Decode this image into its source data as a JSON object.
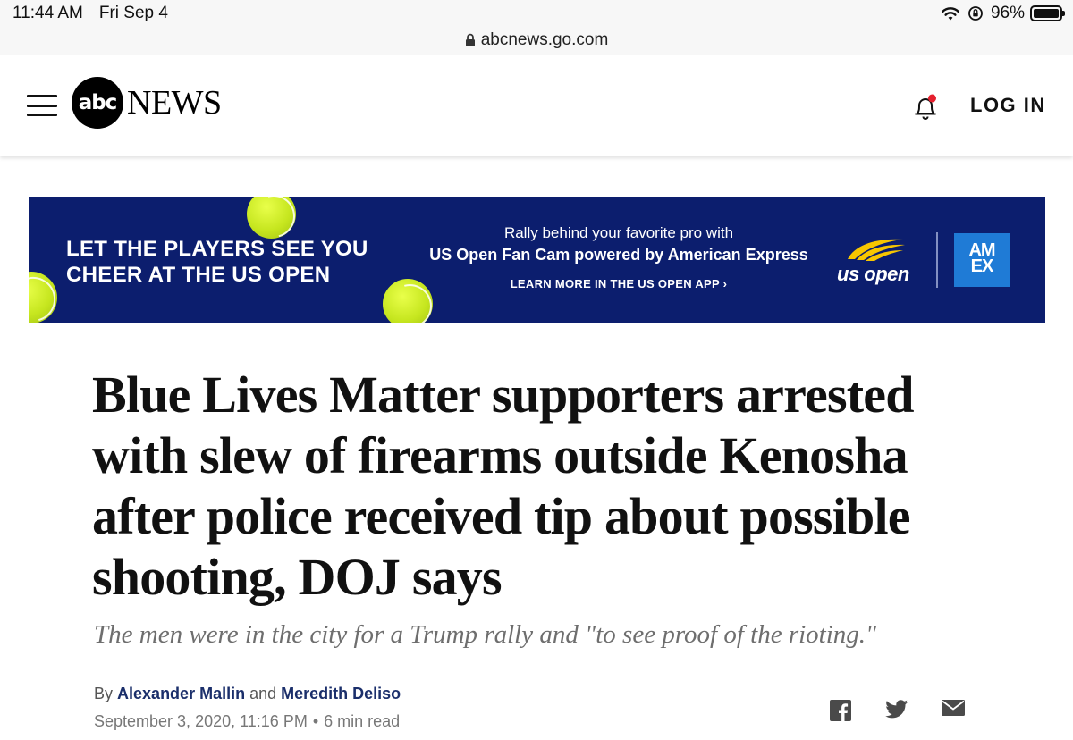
{
  "status_bar": {
    "time": "11:44 AM",
    "date": "Fri Sep 4",
    "battery": "96%"
  },
  "browser": {
    "url": "abcnews.go.com"
  },
  "site_header": {
    "logo_mark": "abc",
    "logo_word": "NEWS",
    "login_label": "LOG IN",
    "notification_dot_color": "#e5202e"
  },
  "ad": {
    "headline_line1": "LET THE PLAYERS SEE YOU",
    "headline_line2": "CHEER AT THE US OPEN",
    "body_line1": "Rally behind your favorite pro with",
    "body_line2": "US Open Fan Cam powered by American Express",
    "cta": "LEARN MORE IN THE US OPEN APP",
    "brand": "us open",
    "sponsor_line1": "AM",
    "sponsor_line2": "EX",
    "background_color": "#0c1e6e"
  },
  "article": {
    "headline": "Blue Lives Matter supporters arrested with slew of firearms outside Kenosha after police received tip about possible shooting, DOJ says",
    "subhead": "The men were in the city for a Trump rally and \"to see proof of the rioting.\"",
    "byline_prefix": "By",
    "author1": "Alexander Mallin",
    "byline_join": "and",
    "author2": "Meredith Deliso",
    "date": "September 3, 2020, 11:16 PM",
    "read_time": "6 min read"
  },
  "share_icons": [
    "facebook-icon",
    "twitter-icon",
    "email-icon"
  ]
}
